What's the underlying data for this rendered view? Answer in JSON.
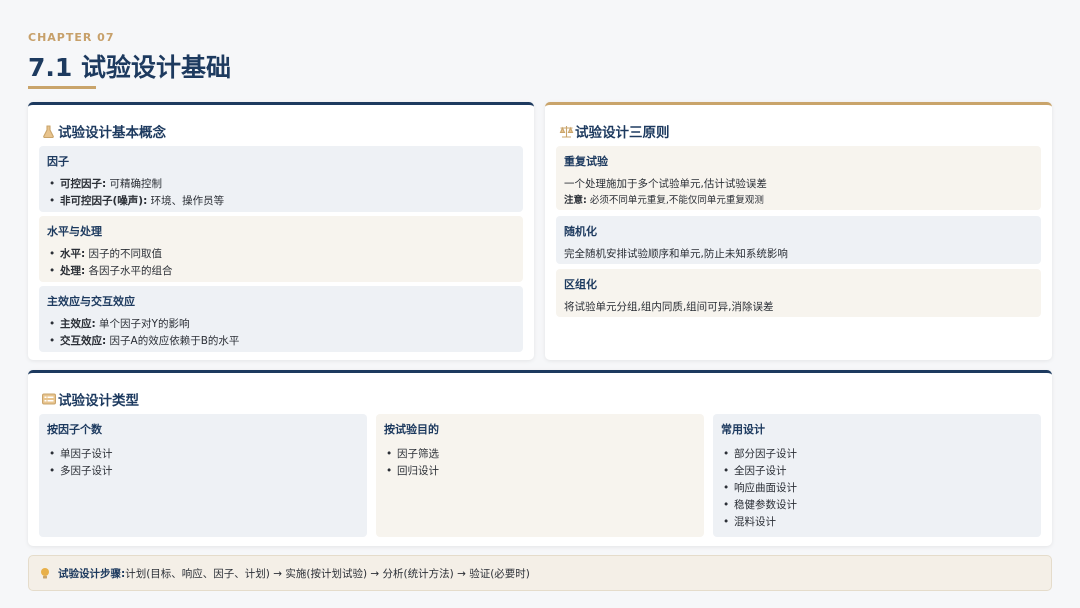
{
  "header": {
    "chapter": "CHAPTER 07",
    "title": "7.1 试验设计基础"
  },
  "concepts": {
    "title": "试验设计基本概念",
    "icon": "flask-icon",
    "sections": [
      {
        "title": "因子",
        "items": [
          {
            "term": "可控因子:",
            "text": " 可精确控制"
          },
          {
            "term": "非可控因子(噪声):",
            "text": " 环境、操作员等"
          }
        ]
      },
      {
        "title": "水平与处理",
        "items": [
          {
            "term": "水平:",
            "text": " 因子的不同取值"
          },
          {
            "term": "处理:",
            "text": " 各因子水平的组合"
          }
        ]
      },
      {
        "title": "主效应与交互效应",
        "items": [
          {
            "term": "主效应:",
            "text": " 单个因子对Y的影响"
          },
          {
            "term": "交互效应:",
            "text": " 因子A的效应依赖于B的水平"
          }
        ]
      }
    ]
  },
  "principles": {
    "title": "试验设计三原则",
    "icon": "balance-scale-icon",
    "sections": [
      {
        "title": "重复试验",
        "text": "一个处理施加于多个试验单元,估计试验误差",
        "note_term": "注意:",
        "note_text": " 必须不同单元重复,不能仅同单元重复观测"
      },
      {
        "title": "随机化",
        "text": "完全随机安排试验顺序和单元,防止未知系统影响"
      },
      {
        "title": "区组化",
        "text": "将试验单元分组,组内同质,组间可异,消除误差"
      }
    ]
  },
  "types": {
    "title": "试验设计类型",
    "icon": "list-card-icon",
    "columns": [
      {
        "title": "按因子个数",
        "items": [
          "单因子设计",
          "多因子设计"
        ]
      },
      {
        "title": "按试验目的",
        "items": [
          "因子筛选",
          "回归设计"
        ]
      },
      {
        "title": "常用设计",
        "items": [
          "部分因子设计",
          "全因子设计",
          "响应曲面设计",
          "稳健参数设计",
          "混料设计"
        ]
      }
    ]
  },
  "footer": {
    "icon": "lightbulb-icon",
    "label": "试验设计步骤:",
    "text": " 计划(目标、响应、因子、计划) → 实施(按计划试验) → 分析(统计方法) → 验证(必要时)"
  }
}
